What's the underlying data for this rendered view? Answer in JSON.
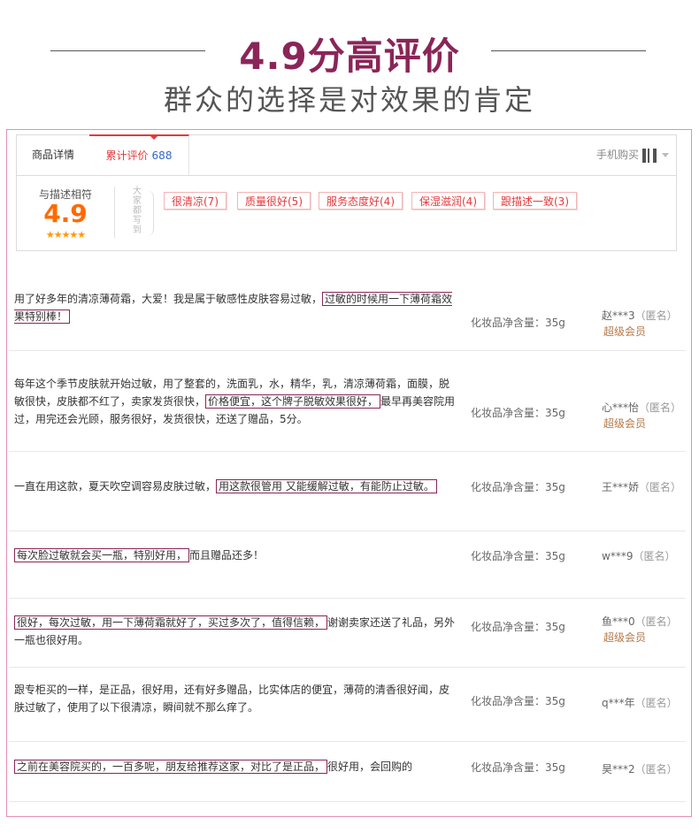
{
  "banner": {
    "headline": "4.9分高评价",
    "subline": "群众的选择是对效果的肯定"
  },
  "tabs": {
    "details": "商品详情",
    "reviews": "累计评价",
    "review_count": "688",
    "mobile_buy": "手机购买"
  },
  "summary": {
    "match_label": "与描述相符",
    "score": "4.9",
    "stars": "★★★★★",
    "vertical_label": "大家都写到",
    "tags": [
      "很清凉(7)",
      "质量很好(5)",
      "服务态度好(4)",
      "保湿滋润(4)",
      "跟描述一致(3)"
    ]
  },
  "reviews": [
    {
      "text_pre": "用了好多年的清凉薄荷霜，大爱！我是属于敏感性皮肤容易过敏，",
      "text_hl": "过敏的时候用一下薄荷霜效果特别棒！",
      "text_post": "",
      "spec": "化妆品净含量：35g",
      "user": "赵***3",
      "anon": "（匿名）",
      "member": "超级会员"
    },
    {
      "text_pre": "每年这个季节皮肤就开始过敏，用了整套的，洗面乳，水，精华，乳，清凉薄荷霜，面膜，脱敏很快，皮肤都不红了，卖家发货很快，",
      "text_hl": "价格便宜，这个牌子脱敏效果很好，",
      "text_post": "最早再美容院用过，用完还会光顾，服务很好，发货很快，还送了赠品，5分。",
      "spec": "化妆品净含量：35g",
      "user": "心***怡",
      "anon": "（匿名）",
      "member": "超级会员"
    },
    {
      "text_pre": "一直在用这款，夏天吹空调容易皮肤过敏，",
      "text_hl": "用这款很管用 又能缓解过敏，有能防止过敏。",
      "text_post": "",
      "spec": "化妆品净含量：35g",
      "user": "王***娇",
      "anon": "（匿名）",
      "member": ""
    },
    {
      "text_pre": "",
      "text_hl": "每次脸过敏就会买一瓶，特别好用，",
      "text_post": "而且赠品还多！",
      "spec": "化妆品净含量：35g",
      "user": "w***9",
      "anon": "（匿名）",
      "member": ""
    },
    {
      "text_pre": "",
      "text_hl": "很好，每次过敏，用一下薄荷霜就好了，买过多次了，值得信赖，",
      "text_post": "谢谢卖家还送了礼品，另外一瓶也很好用。",
      "spec": "化妆品净含量：35g",
      "user": "鱼***0",
      "anon": "（匿名）",
      "member": "超级会员"
    },
    {
      "text_pre": "跟专柜买的一样，是正品，很好用，还有好多赠品，比实体店的便宜，薄荷的清香很好闻，皮肤过敏了，使用了以下很清凉，瞬间就不那么痒了。",
      "text_hl": "",
      "text_post": "",
      "spec": "化妆品净含量：35g",
      "user": "q***年",
      "anon": "（匿名）",
      "member": ""
    },
    {
      "text_pre": "",
      "text_hl": "之前在美容院买的，一百多呢，朋友给推荐这家，对比了是正品，",
      "text_post": "很好用，会回购的",
      "spec": "化妆品净含量：35g",
      "user": "昊***2",
      "anon": "（匿名）",
      "member": ""
    }
  ]
}
